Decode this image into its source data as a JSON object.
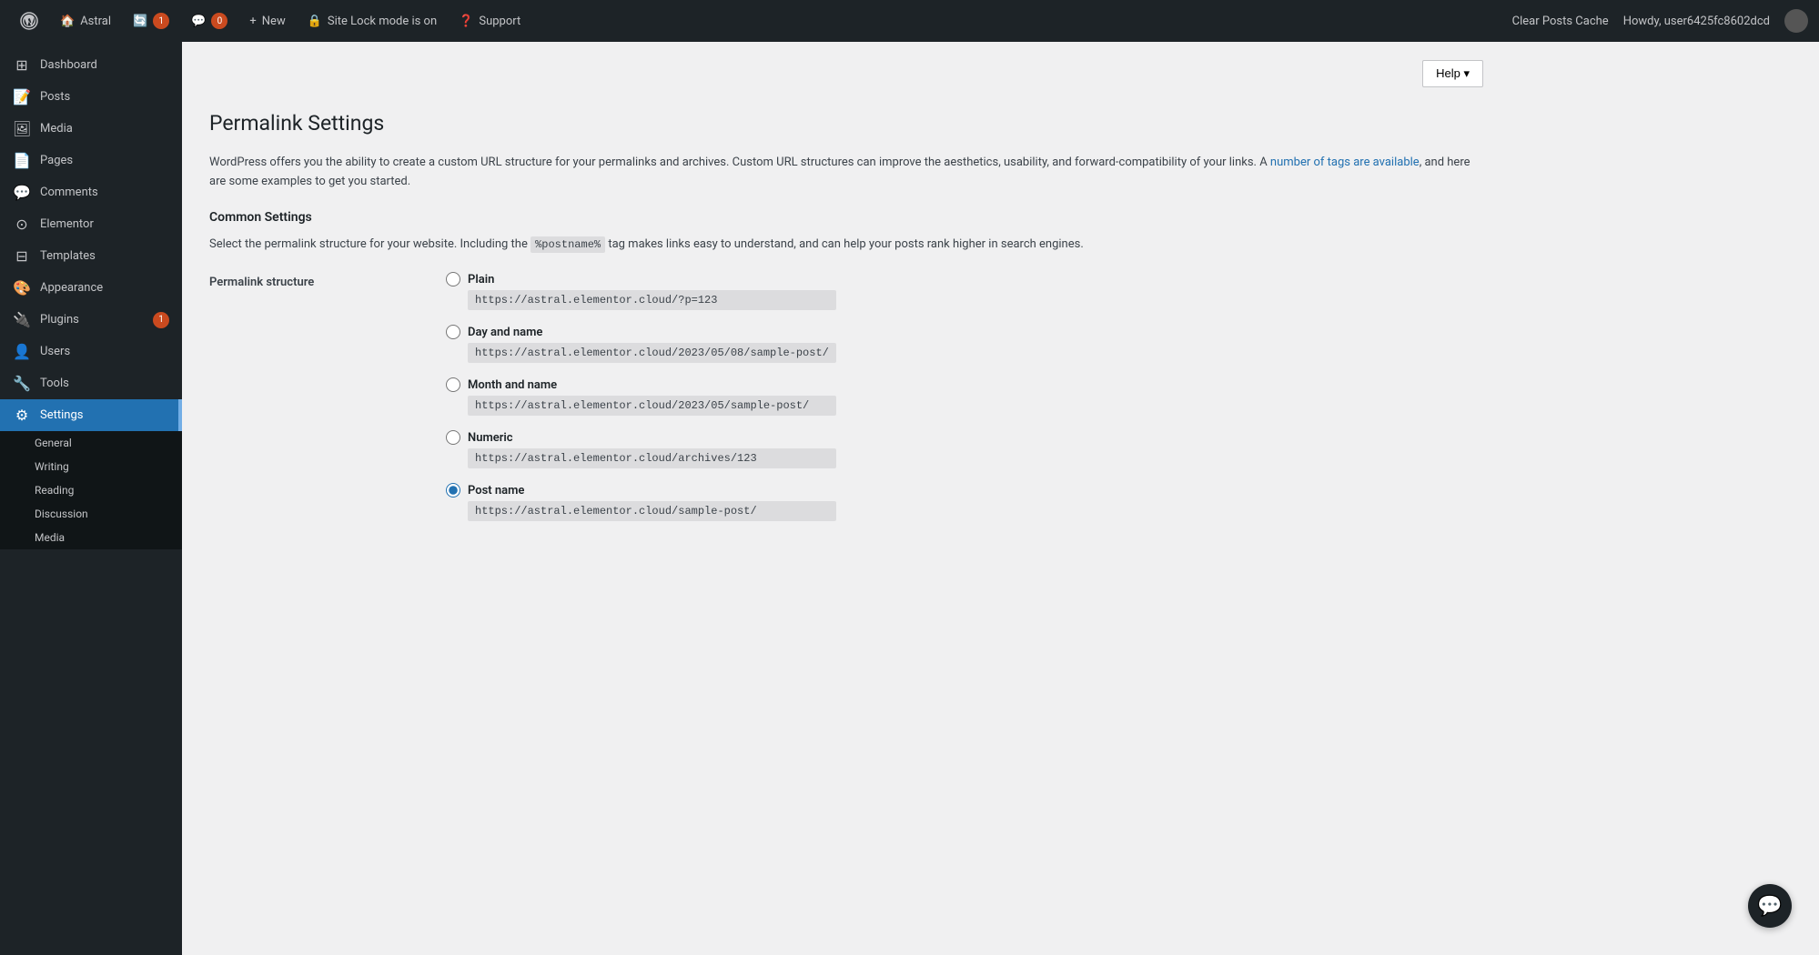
{
  "adminbar": {
    "wp_logo": "⚙",
    "items": [
      {
        "id": "wp-logo",
        "icon": "🏠",
        "label": "Astral"
      },
      {
        "id": "updates",
        "icon": "🔄",
        "label": "1",
        "badge": true
      },
      {
        "id": "comments",
        "icon": "💬",
        "label": "0",
        "badge": true
      },
      {
        "id": "new",
        "icon": "+",
        "label": "New"
      },
      {
        "id": "site-lock",
        "icon": "🔒",
        "label": "Site Lock mode is on"
      },
      {
        "id": "support",
        "icon": "❓",
        "label": "Support"
      }
    ],
    "right": {
      "clear_cache": "Clear Posts Cache",
      "howdy": "Howdy, user6425fc8602dcd"
    }
  },
  "sidebar": {
    "items": [
      {
        "id": "dashboard",
        "icon": "⊞",
        "label": "Dashboard"
      },
      {
        "id": "posts",
        "icon": "📝",
        "label": "Posts"
      },
      {
        "id": "media",
        "icon": "🖼",
        "label": "Media"
      },
      {
        "id": "pages",
        "icon": "📄",
        "label": "Pages"
      },
      {
        "id": "comments",
        "icon": "💬",
        "label": "Comments"
      },
      {
        "id": "elementor",
        "icon": "⊙",
        "label": "Elementor"
      },
      {
        "id": "templates",
        "icon": "⊟",
        "label": "Templates"
      },
      {
        "id": "appearance",
        "icon": "🎨",
        "label": "Appearance"
      },
      {
        "id": "plugins",
        "icon": "🔌",
        "label": "Plugins",
        "badge": "1"
      },
      {
        "id": "users",
        "icon": "👤",
        "label": "Users"
      },
      {
        "id": "tools",
        "icon": "🔧",
        "label": "Tools"
      },
      {
        "id": "settings",
        "icon": "⚙",
        "label": "Settings",
        "active": true
      }
    ],
    "settings_submenu": [
      {
        "id": "general",
        "label": "General"
      },
      {
        "id": "writing",
        "label": "Writing"
      },
      {
        "id": "reading",
        "label": "Reading"
      },
      {
        "id": "discussion",
        "label": "Discussion"
      },
      {
        "id": "media",
        "label": "Media"
      }
    ]
  },
  "page": {
    "title": "Permalink Settings",
    "help_button": "Help ▾",
    "intro": "WordPress offers you the ability to create a custom URL structure for your permalinks and archives. Custom URL structures can improve the aesthetics, usability, and forward-compatibility of your links. A ",
    "intro_link": "number of tags are available",
    "intro_end": ", and here are some examples to get you started.",
    "common_settings_title": "Common Settings",
    "permalink_desc_start": "Select the permalink structure for your website. Including the ",
    "postname_tag": "%postname%",
    "permalink_desc_end": " tag makes links easy to understand, and can help your posts rank higher in search engines.",
    "permalink_structure_label": "Permalink structure",
    "options": [
      {
        "id": "plain",
        "label": "Plain",
        "url": "https://astral.elementor.cloud/?p=123",
        "checked": false
      },
      {
        "id": "day-and-name",
        "label": "Day and name",
        "url": "https://astral.elementor.cloud/2023/05/08/sample-post/",
        "checked": false
      },
      {
        "id": "month-and-name",
        "label": "Month and name",
        "url": "https://astral.elementor.cloud/2023/05/sample-post/",
        "checked": false
      },
      {
        "id": "numeric",
        "label": "Numeric",
        "url": "https://astral.elementor.cloud/archives/123",
        "checked": false
      },
      {
        "id": "post-name",
        "label": "Post name",
        "url": "https://astral.elementor.cloud/sample-post/",
        "checked": true
      }
    ]
  }
}
